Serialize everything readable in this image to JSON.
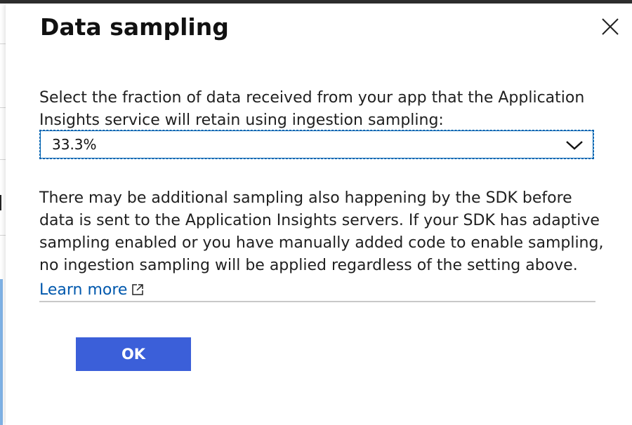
{
  "dialog": {
    "title": "Data sampling",
    "close_icon": "close-icon",
    "description_lines": [
      "Select the fraction of data received from your app that the Application",
      "Insights service will retain using ingestion sampling:"
    ],
    "sampling_select": {
      "selected_value": "33.3%",
      "icon": "chevron-down-icon"
    },
    "note_lines": [
      "There may be additional sampling also happening by the SDK before",
      "data is sent to the Application Insights servers. If your SDK has adaptive",
      "sampling enabled or you have manually added code to enable sampling,",
      "no ingestion sampling will be applied regardless of the setting above."
    ],
    "learn_more": {
      "label": "Learn more",
      "icon": "external-link-icon"
    },
    "ok_label": "OK"
  },
  "colors": {
    "link": "#0058ad",
    "primary_button": "#3b5fd9",
    "focus_border": "#0063b1",
    "top_strip": "#2f2f2f",
    "background_accent": "#7fb2e5"
  }
}
